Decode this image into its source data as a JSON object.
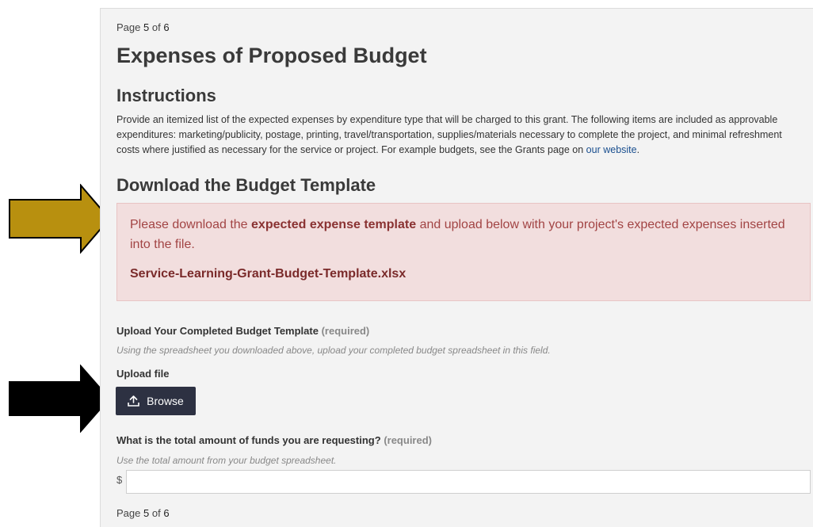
{
  "page_indicator": {
    "prefix": "Page",
    "current": "5",
    "of": "of",
    "total": "6"
  },
  "title": "Expenses of Proposed Budget",
  "instructions": {
    "heading": "Instructions",
    "text": "Provide an itemized list of the expected expenses by expenditure type that will be charged to this grant. The following items are included as approvable expenditures: marketing/publicity, postage, printing, travel/transportation, supplies/materials necessary to complete the project, and minimal refreshment costs where justified as necessary for the service or project. For example budgets, see the Grants page on",
    "link_text": "our website",
    "suffix": "."
  },
  "template_section": {
    "heading": "Download the Budget Template",
    "alert_prefix": "Please download the",
    "alert_bold": "expected expense template",
    "alert_suffix": "and upload below with your project's expected expenses inserted into the file.",
    "file_link": "Service-Learning-Grant-Budget-Template.xlsx"
  },
  "upload_field": {
    "label": "Upload Your Completed Budget Template",
    "required": "(required)",
    "hint": "Using the spreadsheet you downloaded above, upload your completed budget spreadsheet in this field.",
    "sub_label": "Upload file",
    "button_label": "Browse",
    "icon": "upload-icon"
  },
  "amount_field": {
    "label": "What is the total amount of funds you are requesting?",
    "required": "(required)",
    "hint": "Use the total amount from your budget spreadsheet.",
    "currency_symbol": "$",
    "value": ""
  },
  "annotations": {
    "gold_arrow_color": "#b8900f",
    "black_arrow_color": "#000000"
  },
  "colors": {
    "alert_bg": "#f2dede",
    "alert_text": "#a24444",
    "button_bg": "#2d3142",
    "link": "#1a4f8f"
  }
}
